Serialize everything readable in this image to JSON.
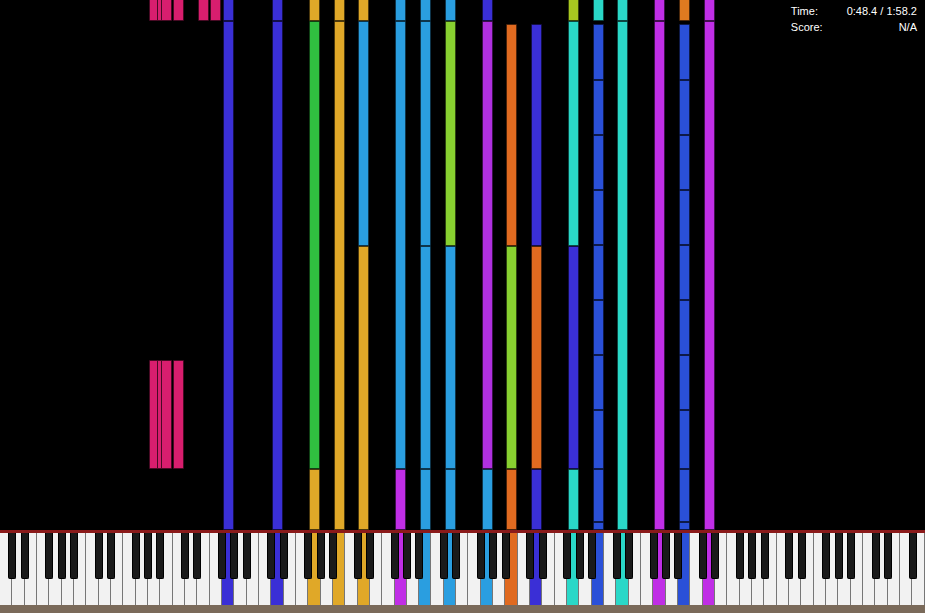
{
  "status": {
    "time_label": "Time:",
    "time": "0:48.4 / 1:58.2",
    "score_label": "Score:",
    "score": "N/A"
  },
  "notes": [
    {
      "key": 12,
      "black": false,
      "color": "#d81e6e",
      "start": 1.15,
      "end": 3.2
    },
    {
      "key": 12,
      "black": true,
      "color": "#d81e6e",
      "start": 1.15,
      "end": 3.2
    },
    {
      "key": 13,
      "black": false,
      "color": "#d81e6e",
      "start": 1.15,
      "end": 3.2
    },
    {
      "key": 14,
      "black": false,
      "color": "#d81e6e",
      "start": 1.15,
      "end": 3.2
    },
    {
      "key": 12,
      "black": false,
      "color": "#d81e6e",
      "start": 9.6,
      "end": 10.5
    },
    {
      "key": 12,
      "black": true,
      "color": "#d81e6e",
      "start": 9.6,
      "end": 10.5
    },
    {
      "key": 13,
      "black": false,
      "color": "#d81e6e",
      "start": 9.6,
      "end": 10.5
    },
    {
      "key": 14,
      "black": false,
      "color": "#d81e6e",
      "start": 9.6,
      "end": 10.5
    },
    {
      "key": 16,
      "black": false,
      "color": "#d81e6e",
      "start": 9.6,
      "end": 10.5
    },
    {
      "key": 17,
      "black": false,
      "color": "#d81e6e",
      "start": 9.6,
      "end": 10.5
    },
    {
      "key": 18,
      "black": false,
      "color": "#3a2fd6",
      "start": 0,
      "end": 9.6
    },
    {
      "key": 18,
      "black": false,
      "color": "#3a2fd6",
      "start": 9.6,
      "end": 10.5
    },
    {
      "key": 22,
      "black": false,
      "color": "#3a2fd6",
      "start": 0,
      "end": 9.6
    },
    {
      "key": 22,
      "black": false,
      "color": "#3a2fd6",
      "start": 9.6,
      "end": 10.5
    },
    {
      "key": 25,
      "black": false,
      "color": "#e0a828",
      "start": 0,
      "end": 1.15
    },
    {
      "key": 25,
      "black": false,
      "color": "#30c040",
      "start": 1.15,
      "end": 9.6
    },
    {
      "key": 25,
      "black": false,
      "color": "#e0a828",
      "start": 9.6,
      "end": 10.5
    },
    {
      "key": 27,
      "black": false,
      "color": "#e0a828",
      "start": 0,
      "end": 9.6
    },
    {
      "key": 27,
      "black": false,
      "color": "#e0a828",
      "start": 9.6,
      "end": 10.5
    },
    {
      "key": 29,
      "black": false,
      "color": "#e0a828",
      "start": 0,
      "end": 5.35
    },
    {
      "key": 29,
      "black": false,
      "color": "#2a9ee0",
      "start": 5.35,
      "end": 9.6
    },
    {
      "key": 29,
      "black": false,
      "color": "#e0a828",
      "start": 9.6,
      "end": 10.5
    },
    {
      "key": 32,
      "black": false,
      "color": "#c02ee6",
      "start": 0,
      "end": 1.15
    },
    {
      "key": 32,
      "black": false,
      "color": "#2a9ee0",
      "start": 1.15,
      "end": 9.6
    },
    {
      "key": 32,
      "black": false,
      "color": "#2a9ee0",
      "start": 9.6,
      "end": 10.5
    },
    {
      "key": 34,
      "black": false,
      "color": "#2a9ee0",
      "start": 0,
      "end": 1.15
    },
    {
      "key": 34,
      "black": false,
      "color": "#2a9ee0",
      "start": 1.15,
      "end": 5.35
    },
    {
      "key": 34,
      "black": false,
      "color": "#2a9ee0",
      "start": 5.35,
      "end": 9.6
    },
    {
      "key": 34,
      "black": false,
      "color": "#2a9ee0",
      "start": 9.6,
      "end": 10.5
    },
    {
      "key": 36,
      "black": false,
      "color": "#2a9ee0",
      "start": 0,
      "end": 1.15
    },
    {
      "key": 36,
      "black": false,
      "color": "#2a9ee0",
      "start": 1.15,
      "end": 5.35
    },
    {
      "key": 36,
      "black": false,
      "color": "#88d030",
      "start": 5.35,
      "end": 9.6
    },
    {
      "key": 36,
      "black": false,
      "color": "#2a9ee0",
      "start": 9.6,
      "end": 10.5
    },
    {
      "key": 39,
      "black": false,
      "color": "#2a9ee0",
      "start": 0,
      "end": 1.15
    },
    {
      "key": 39,
      "black": false,
      "color": "#b030e0",
      "start": 1.15,
      "end": 9.6
    },
    {
      "key": 39,
      "black": false,
      "color": "#3a2fd6",
      "start": 9.6,
      "end": 10.5
    },
    {
      "key": 41,
      "black": false,
      "color": "#e06a20",
      "start": 0,
      "end": 1.15
    },
    {
      "key": 41,
      "black": false,
      "color": "#88d030",
      "start": 1.15,
      "end": 5.35
    },
    {
      "key": 41,
      "black": false,
      "color": "#e06a20",
      "start": 5.35,
      "end": 9.55
    },
    {
      "key": 43,
      "black": false,
      "color": "#3a2fd6",
      "start": 0,
      "end": 1.15
    },
    {
      "key": 43,
      "black": false,
      "color": "#e06a20",
      "start": 1.15,
      "end": 5.35
    },
    {
      "key": 43,
      "black": false,
      "color": "#3a2fd6",
      "start": 5.35,
      "end": 9.55
    },
    {
      "key": 46,
      "black": false,
      "color": "#2ad8c8",
      "start": 0,
      "end": 1.15
    },
    {
      "key": 46,
      "black": false,
      "color": "#3a2fd6",
      "start": 1.15,
      "end": 5.35
    },
    {
      "key": 46,
      "black": false,
      "color": "#2ad8c8",
      "start": 5.35,
      "end": 9.6
    },
    {
      "key": 46,
      "black": false,
      "color": "#a8c820",
      "start": 9.6,
      "end": 10.5
    },
    {
      "key": 48,
      "black": false,
      "color": "#2a50d8",
      "start": 0,
      "end": 0.15
    },
    {
      "key": 48,
      "black": false,
      "color": "#2a50d8",
      "start": 0.15,
      "end": 1.15
    },
    {
      "key": 48,
      "black": false,
      "color": "#2a50d8",
      "start": 1.15,
      "end": 2.26
    },
    {
      "key": 48,
      "black": false,
      "color": "#2a50d8",
      "start": 2.26,
      "end": 3.3
    },
    {
      "key": 48,
      "black": false,
      "color": "#2a50d8",
      "start": 3.3,
      "end": 4.34
    },
    {
      "key": 48,
      "black": false,
      "color": "#2a50d8",
      "start": 4.34,
      "end": 5.38
    },
    {
      "key": 48,
      "black": false,
      "color": "#2a50d8",
      "start": 5.38,
      "end": 6.42
    },
    {
      "key": 48,
      "black": false,
      "color": "#2a50d8",
      "start": 6.42,
      "end": 7.45
    },
    {
      "key": 48,
      "black": false,
      "color": "#2a50d8",
      "start": 7.45,
      "end": 8.49
    },
    {
      "key": 48,
      "black": false,
      "color": "#2a50d8",
      "start": 8.49,
      "end": 9.55
    },
    {
      "key": 48,
      "black": false,
      "color": "#2ad8c8",
      "start": 9.6,
      "end": 10.5
    },
    {
      "key": 50,
      "black": false,
      "color": "#2ad8c8",
      "start": 0,
      "end": 9.6
    },
    {
      "key": 50,
      "black": false,
      "color": "#2ad8c8",
      "start": 9.6,
      "end": 10.5
    },
    {
      "key": 53,
      "black": false,
      "color": "#c02ee6",
      "start": 0,
      "end": 9.6
    },
    {
      "key": 53,
      "black": false,
      "color": "#c02ee6",
      "start": 9.6,
      "end": 10.5
    },
    {
      "key": 55,
      "black": false,
      "color": "#2a50d8",
      "start": 0,
      "end": 0.15
    },
    {
      "key": 55,
      "black": false,
      "color": "#2a50d8",
      "start": 0.15,
      "end": 1.15
    },
    {
      "key": 55,
      "black": false,
      "color": "#2a50d8",
      "start": 1.15,
      "end": 2.26
    },
    {
      "key": 55,
      "black": false,
      "color": "#2a50d8",
      "start": 2.26,
      "end": 3.3
    },
    {
      "key": 55,
      "black": false,
      "color": "#2a50d8",
      "start": 3.3,
      "end": 4.34
    },
    {
      "key": 55,
      "black": false,
      "color": "#2a50d8",
      "start": 4.34,
      "end": 5.38
    },
    {
      "key": 55,
      "black": false,
      "color": "#2a50d8",
      "start": 5.38,
      "end": 6.42
    },
    {
      "key": 55,
      "black": false,
      "color": "#2a50d8",
      "start": 6.42,
      "end": 7.45
    },
    {
      "key": 55,
      "black": false,
      "color": "#2a50d8",
      "start": 7.45,
      "end": 8.49
    },
    {
      "key": 55,
      "black": false,
      "color": "#2a50d8",
      "start": 8.49,
      "end": 9.55
    },
    {
      "key": 55,
      "black": false,
      "color": "#e07a20",
      "start": 9.6,
      "end": 10.5
    },
    {
      "key": 57,
      "black": false,
      "color": "#c02ee6",
      "start": 0,
      "end": 9.6
    },
    {
      "key": 57,
      "black": false,
      "color": "#c02ee6",
      "start": 9.6,
      "end": 10.5
    }
  ]
}
